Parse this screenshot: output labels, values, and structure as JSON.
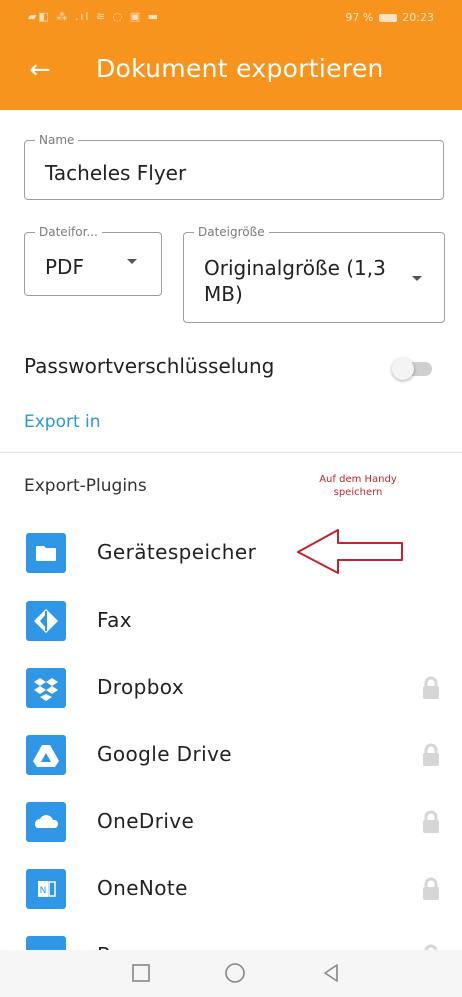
{
  "status_bar": {
    "left": "▰◧ ⁂ .ıl ≋ ◌ ▣ ▬",
    "battery": "97 %",
    "time": "20:23"
  },
  "app_bar": {
    "title": "Dokument exportieren",
    "back_icon": "arrow-left-icon"
  },
  "form": {
    "name": {
      "label": "Name",
      "value": "Tacheles Flyer"
    },
    "format": {
      "label": "Dateifor...",
      "value": "PDF"
    },
    "size": {
      "label": "Dateigröße",
      "value": "Originalgröße (1,3 MB)"
    },
    "password": {
      "label": "Passwortverschlüsselung",
      "enabled": false
    }
  },
  "export_in_link": "Export in",
  "plugins": {
    "header": "Export-Plugins",
    "annotation": "Auf dem Handy speichern",
    "items": [
      {
        "label": "Gerätespeicher",
        "icon": "folder-icon",
        "locked": false
      },
      {
        "label": "Fax",
        "icon": "fax-icon",
        "locked": false
      },
      {
        "label": "Dropbox",
        "icon": "dropbox-icon",
        "locked": true
      },
      {
        "label": "Google Drive",
        "icon": "google-drive-icon",
        "locked": true
      },
      {
        "label": "OneDrive",
        "icon": "onedrive-icon",
        "locked": true
      },
      {
        "label": "OneNote",
        "icon": "onenote-icon",
        "locked": true
      },
      {
        "label": "Box",
        "icon": "box-icon",
        "locked": true
      }
    ]
  },
  "colors": {
    "accent": "#f7941d",
    "link": "#2b98d8",
    "plugin_icon": "#2f97e6",
    "annotation": "#c0252f"
  },
  "nav_bar": {
    "buttons": [
      "recents-square-icon",
      "home-circle-icon",
      "back-triangle-icon"
    ]
  }
}
